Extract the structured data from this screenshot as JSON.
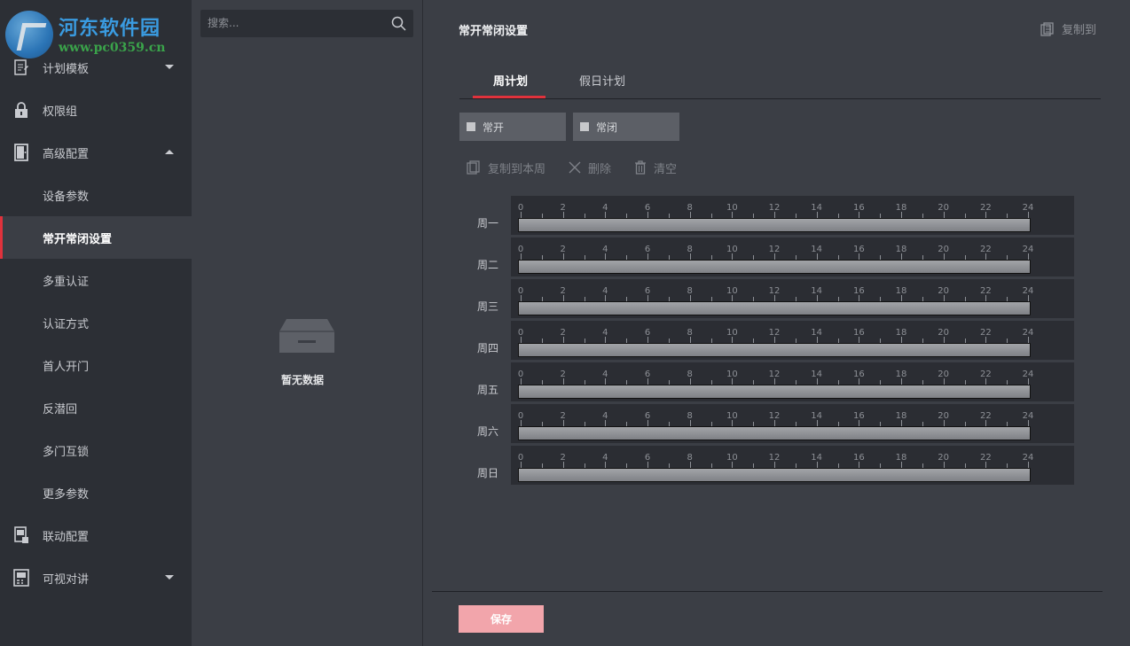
{
  "logo": {
    "title": "河东软件园",
    "url": "www.pc0359.cn"
  },
  "sidebar": {
    "items": [
      {
        "label": "计划模板",
        "icon": "template-icon",
        "caret": "down"
      },
      {
        "label": "权限组",
        "icon": "lock-icon"
      },
      {
        "label": "高级配置",
        "icon": "door-icon",
        "caret": "up"
      },
      {
        "label": "设备参数"
      },
      {
        "label": "常开常闭设置",
        "active": true
      },
      {
        "label": "多重认证"
      },
      {
        "label": "认证方式"
      },
      {
        "label": "首人开门"
      },
      {
        "label": "反潜回"
      },
      {
        "label": "多门互锁"
      },
      {
        "label": "更多参数"
      },
      {
        "label": "联动配置",
        "icon": "linkage-icon"
      },
      {
        "label": "可视对讲",
        "icon": "intercom-icon",
        "caret": "down"
      }
    ]
  },
  "list": {
    "search_placeholder": "搜索...",
    "empty_text": "暂无数据"
  },
  "main": {
    "title": "常开常闭设置",
    "copy_to": "复制到",
    "tabs": [
      {
        "label": "周计划",
        "active": true
      },
      {
        "label": "假日计划"
      }
    ],
    "legend": [
      {
        "label": "常开"
      },
      {
        "label": "常闭"
      }
    ],
    "actions": {
      "copy_week": "复制到本周",
      "delete": "删除",
      "clear": "清空"
    },
    "ticks": [
      "0",
      "2",
      "4",
      "6",
      "8",
      "10",
      "12",
      "14",
      "16",
      "18",
      "20",
      "22",
      "24"
    ],
    "days": [
      "周一",
      "周二",
      "周三",
      "周四",
      "周五",
      "周六",
      "周日"
    ],
    "save": "保存"
  },
  "colors": {
    "accent": "#e0323c",
    "save_button": "#f2a5ab",
    "sidebar_bg": "#2c2f35",
    "panel_bg": "#3b3e45"
  }
}
